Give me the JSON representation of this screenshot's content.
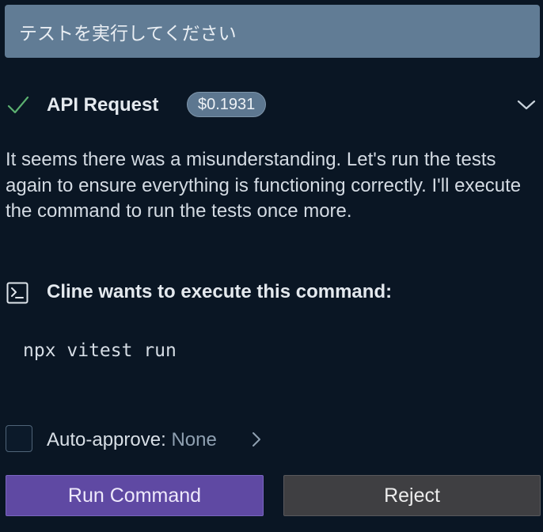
{
  "user_message": {
    "text": "テストを実行してください"
  },
  "api_request": {
    "title": "API Request",
    "cost": "$0.1931",
    "status_icon": "check-icon",
    "expand_icon": "chevron-down-icon"
  },
  "assistant_message": {
    "text": "It seems there was a misunderstanding. Let's run the tests again to ensure everything is functioning correctly. I'll execute the command to run the tests once more."
  },
  "command_request": {
    "icon": "terminal-icon",
    "title": "Cline wants to execute this command:",
    "command": "npx vitest run"
  },
  "auto_approve": {
    "label": "Auto-approve:",
    "value": "None",
    "checked": false
  },
  "actions": {
    "primary_label": "Run Command",
    "secondary_label": "Reject"
  },
  "colors": {
    "background": "#0a1624",
    "user_message_bg": "#617c95",
    "check_green": "#5bb070",
    "primary_button": "#5f49a3",
    "secondary_button": "#3f3f42"
  }
}
